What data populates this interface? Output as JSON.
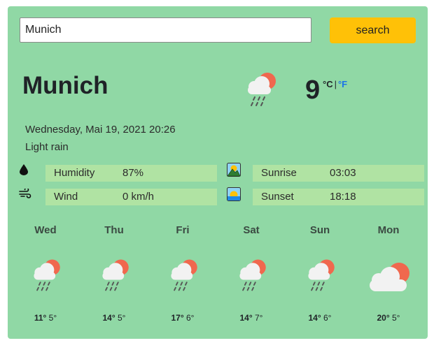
{
  "search": {
    "value": "Munich",
    "button_label": "search"
  },
  "current": {
    "city": "Munich",
    "temperature": "9",
    "unit_c": "°C",
    "unit_separator": "|",
    "unit_f": "°F",
    "datetime": "Wednesday, Mai 19, 2021 20:26",
    "description": "Light rain",
    "icon": "rain-cloud-sun-icon"
  },
  "stats": {
    "humidity": {
      "label": "Humidity",
      "value": "87%",
      "icon": "droplet-icon"
    },
    "wind": {
      "label": "Wind",
      "value": "0 km/h",
      "icon": "wind-icon"
    },
    "sunrise": {
      "label": "Sunrise",
      "value": "03:03",
      "icon": "sunrise-icon"
    },
    "sunset": {
      "label": "Sunset",
      "value": "18:18",
      "icon": "sunset-icon"
    }
  },
  "forecast": [
    {
      "day": "Wed",
      "hi": "11°",
      "lo": "5°",
      "icon": "rain-cloud-sun-icon"
    },
    {
      "day": "Thu",
      "hi": "14°",
      "lo": "5°",
      "icon": "rain-cloud-sun-icon"
    },
    {
      "day": "Fri",
      "hi": "17°",
      "lo": "6°",
      "icon": "rain-cloud-sun-icon"
    },
    {
      "day": "Sat",
      "hi": "14°",
      "lo": "7°",
      "icon": "rain-cloud-sun-icon"
    },
    {
      "day": "Sun",
      "hi": "14°",
      "lo": "6°",
      "icon": "rain-cloud-sun-icon"
    },
    {
      "day": "Mon",
      "hi": "20°",
      "lo": "5°",
      "icon": "cloud-sun-icon"
    }
  ],
  "colors": {
    "card_background": "#90d8a5",
    "stat_background": "#b0e3a3",
    "search_button": "#ffc107",
    "fahrenheit_link": "#1a73e8",
    "sun": "#f0684e",
    "cloud": "#f2f2f2",
    "rain": "#555555"
  }
}
